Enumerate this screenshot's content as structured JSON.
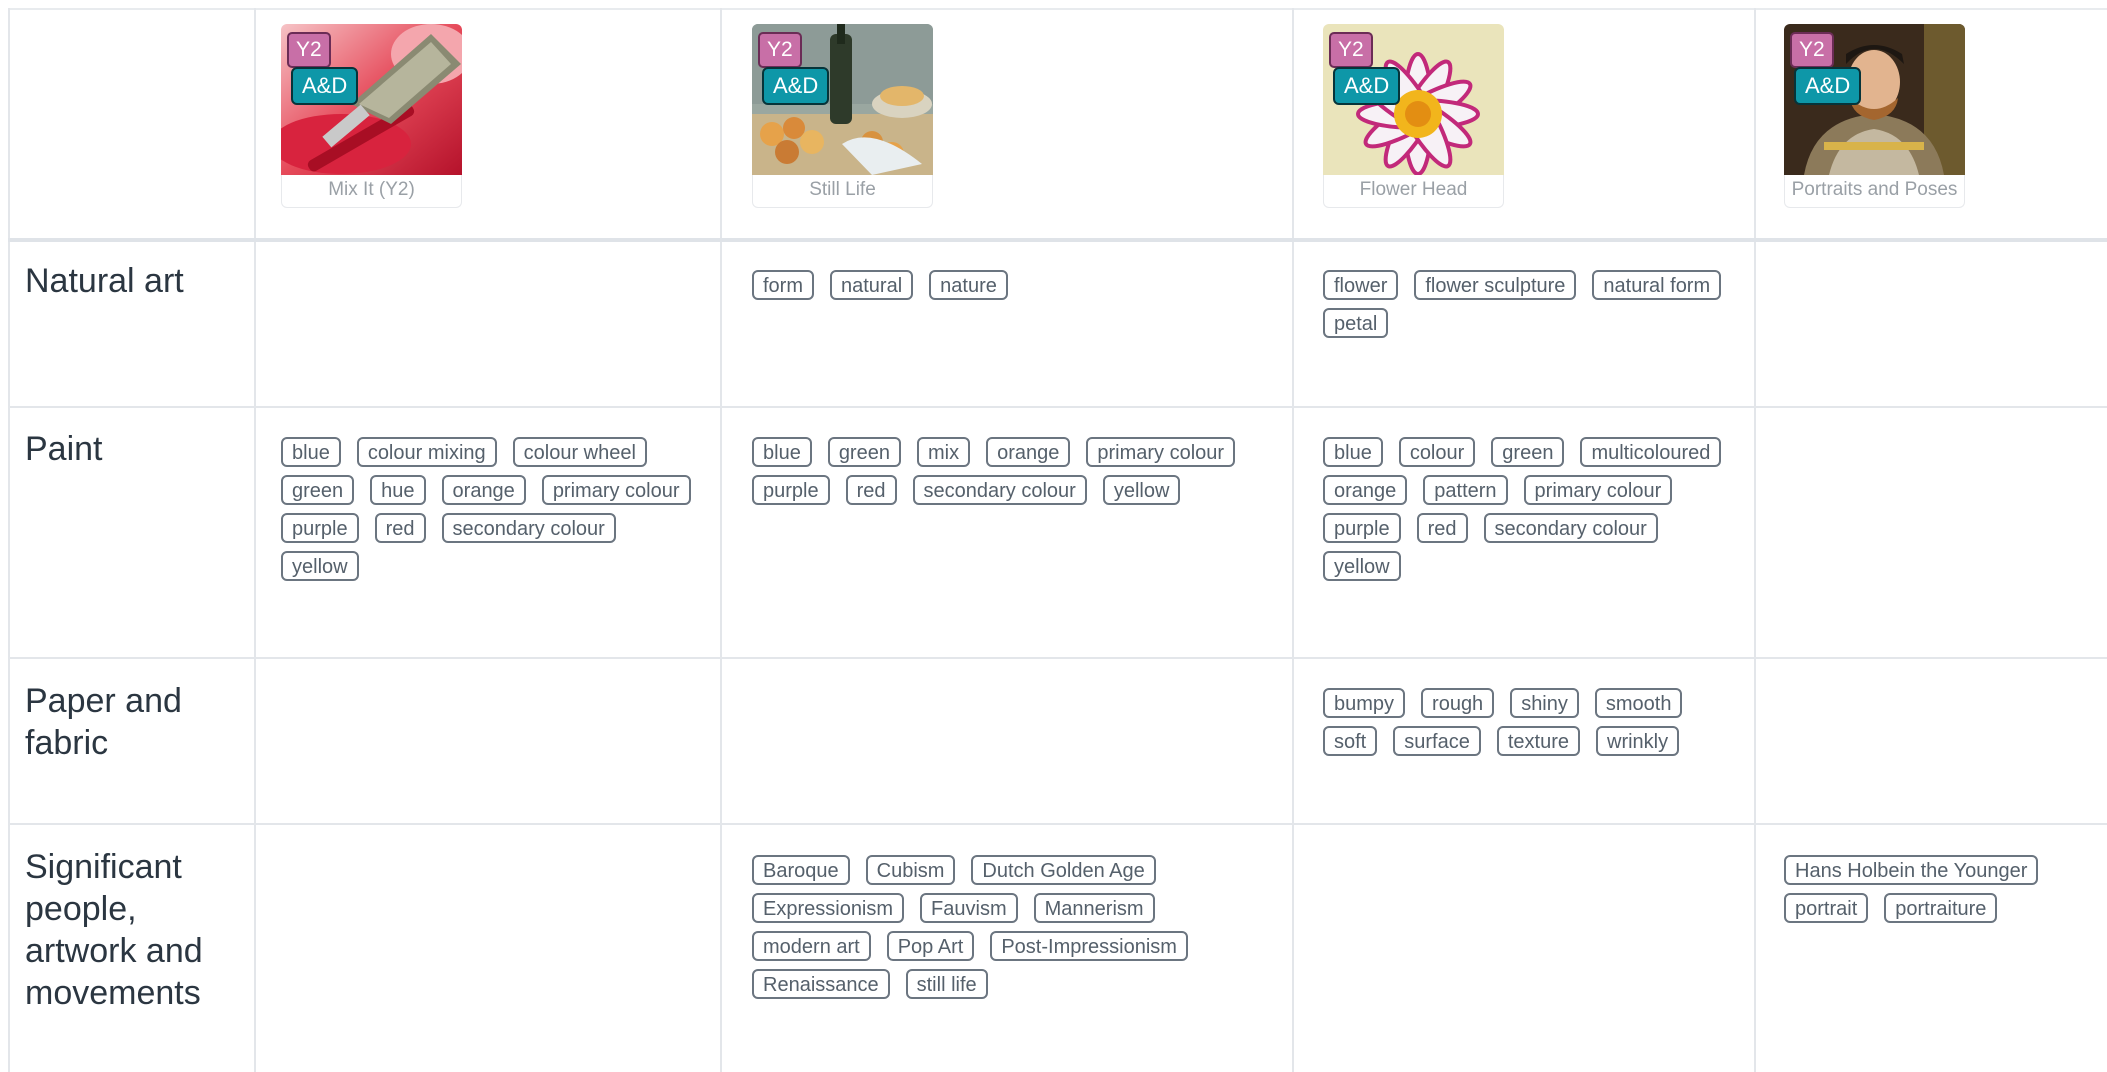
{
  "units": [
    {
      "year": "Y2",
      "subject": "A&D",
      "title": "Mix It (Y2)",
      "image": "paint-brush"
    },
    {
      "year": "Y2",
      "subject": "A&D",
      "title": "Still Life",
      "image": "still-life-painting"
    },
    {
      "year": "Y2",
      "subject": "A&D",
      "title": "Flower Head",
      "image": "flower"
    },
    {
      "year": "Y2",
      "subject": "A&D",
      "title": "Portraits and Poses",
      "image": "portrait-painting"
    }
  ],
  "rows": [
    {
      "label": "Natural art",
      "cells": [
        [],
        [
          "form",
          "natural",
          "nature"
        ],
        [
          "flower",
          "flower sculpture",
          "natural form",
          "petal"
        ],
        []
      ]
    },
    {
      "label": "Paint",
      "cells": [
        [
          "blue",
          "colour mixing",
          "colour wheel",
          "green",
          "hue",
          "orange",
          "primary colour",
          "purple",
          "red",
          "secondary colour",
          "yellow"
        ],
        [
          "blue",
          "green",
          "mix",
          "orange",
          "primary colour",
          "purple",
          "red",
          "secondary colour",
          "yellow"
        ],
        [
          "blue",
          "colour",
          "green",
          "multicoloured",
          "orange",
          "pattern",
          "primary colour",
          "purple",
          "red",
          "secondary colour",
          "yellow"
        ],
        []
      ]
    },
    {
      "label": "Paper and fabric",
      "cells": [
        [],
        [],
        [
          "bumpy",
          "rough",
          "shiny",
          "smooth",
          "soft",
          "surface",
          "texture",
          "wrinkly"
        ],
        []
      ]
    },
    {
      "label": "Significant people, artwork and movements",
      "cells": [
        [],
        [
          "Baroque",
          "Cubism",
          "Dutch Golden Age",
          "Expressionism",
          "Fauvism",
          "Mannerism",
          "modern art",
          "Pop Art",
          "Post-Impressionism",
          "Renaissance",
          "still life"
        ],
        [],
        [
          "Hans Holbein the Younger",
          "portrait",
          "portraiture"
        ]
      ]
    }
  ],
  "colors": {
    "year_badge": "#c86fa7",
    "subject_badge": "#0e97a8",
    "tag_border": "#6b7580",
    "grid_line": "#e3e6ea"
  }
}
